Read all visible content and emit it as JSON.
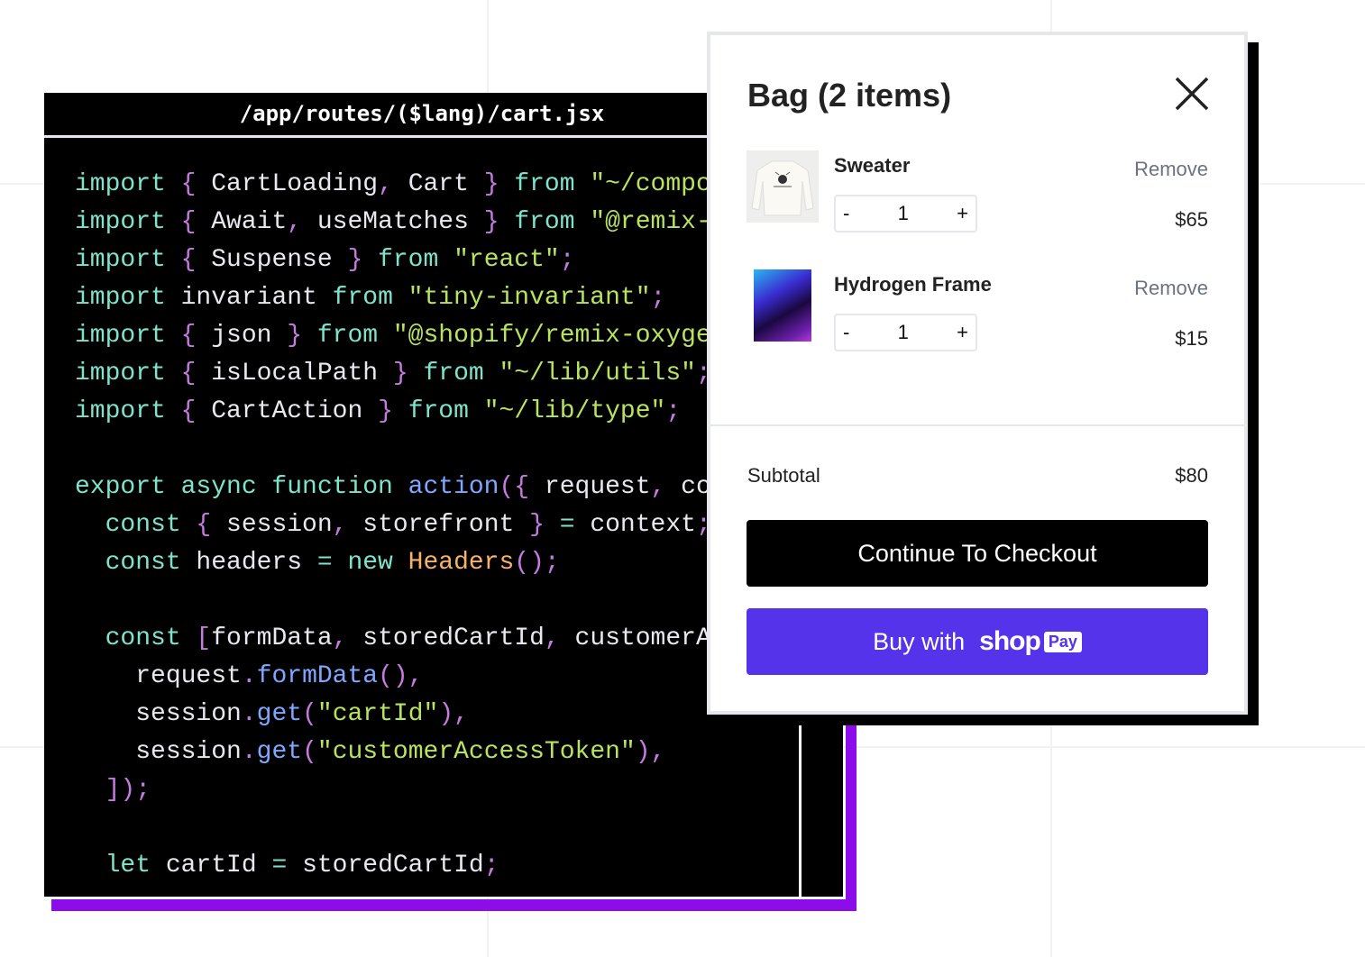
{
  "code_panel": {
    "filename": "/app/routes/($lang)/cart.jsx",
    "lines": [
      [
        [
          "import ",
          "kw"
        ],
        [
          "{ ",
          "pu"
        ],
        [
          "CartLoading",
          "id"
        ],
        [
          ", ",
          "pu"
        ],
        [
          "Cart ",
          "id"
        ],
        [
          "} ",
          "pu"
        ],
        [
          "from ",
          "kw"
        ],
        [
          "\"~/compo",
          "st"
        ]
      ],
      [
        [
          "import ",
          "kw"
        ],
        [
          "{ ",
          "pu"
        ],
        [
          "Await",
          "id"
        ],
        [
          ", ",
          "pu"
        ],
        [
          "useMatches ",
          "id"
        ],
        [
          "} ",
          "pu"
        ],
        [
          "from ",
          "kw"
        ],
        [
          "\"@remix-",
          "st"
        ]
      ],
      [
        [
          "import ",
          "kw"
        ],
        [
          "{ ",
          "pu"
        ],
        [
          "Suspense ",
          "id"
        ],
        [
          "} ",
          "pu"
        ],
        [
          "from ",
          "kw"
        ],
        [
          "\"react\"",
          "st"
        ],
        [
          ";",
          "pu"
        ]
      ],
      [
        [
          "import ",
          "kw"
        ],
        [
          "invariant ",
          "id"
        ],
        [
          "from ",
          "kw"
        ],
        [
          "\"tiny-invariant\"",
          "st"
        ],
        [
          ";",
          "pu"
        ]
      ],
      [
        [
          "import ",
          "kw"
        ],
        [
          "{ ",
          "pu"
        ],
        [
          "json ",
          "id"
        ],
        [
          "} ",
          "pu"
        ],
        [
          "from ",
          "kw"
        ],
        [
          "\"@shopify/remix-oxyge",
          "st"
        ]
      ],
      [
        [
          "import ",
          "kw"
        ],
        [
          "{ ",
          "pu"
        ],
        [
          "isLocalPath ",
          "id"
        ],
        [
          "} ",
          "pu"
        ],
        [
          "from ",
          "kw"
        ],
        [
          "\"~/lib/utils\"",
          "st"
        ],
        [
          ";",
          "pu"
        ]
      ],
      [
        [
          "import ",
          "kw"
        ],
        [
          "{ ",
          "pu"
        ],
        [
          "CartAction ",
          "id"
        ],
        [
          "} ",
          "pu"
        ],
        [
          "from ",
          "kw"
        ],
        [
          "\"~/lib/type\"",
          "st"
        ],
        [
          ";",
          "pu"
        ]
      ],
      [],
      [
        [
          "export async function ",
          "kw"
        ],
        [
          "action",
          "fn"
        ],
        [
          "({ ",
          "pu"
        ],
        [
          "request",
          "id"
        ],
        [
          ", ",
          "pu"
        ],
        [
          "co",
          "id"
        ]
      ],
      [
        [
          "  const ",
          "kw"
        ],
        [
          "{ ",
          "pu"
        ],
        [
          "session",
          "id"
        ],
        [
          ", ",
          "pu"
        ],
        [
          "storefront ",
          "id"
        ],
        [
          "} ",
          "pu"
        ],
        [
          "= ",
          "kw"
        ],
        [
          "context",
          "id"
        ],
        [
          ";",
          "pu"
        ]
      ],
      [
        [
          "  const ",
          "kw"
        ],
        [
          "headers ",
          "id"
        ],
        [
          "= new ",
          "kw"
        ],
        [
          "Headers",
          "cl"
        ],
        [
          "();",
          "pu"
        ]
      ],
      [],
      [
        [
          "  const ",
          "kw"
        ],
        [
          "[",
          "pu"
        ],
        [
          "formData",
          "id"
        ],
        [
          ", ",
          "pu"
        ],
        [
          "storedCartId",
          "id"
        ],
        [
          ", ",
          "pu"
        ],
        [
          "customerA",
          "id"
        ]
      ],
      [
        [
          "    request",
          "id"
        ],
        [
          ".",
          "pu"
        ],
        [
          "formData",
          "fn"
        ],
        [
          "(),",
          "pu"
        ]
      ],
      [
        [
          "    session",
          "id"
        ],
        [
          ".",
          "pu"
        ],
        [
          "get",
          "fn"
        ],
        [
          "(",
          "pu"
        ],
        [
          "\"cartId\"",
          "st"
        ],
        [
          "),",
          "pu"
        ]
      ],
      [
        [
          "    session",
          "id"
        ],
        [
          ".",
          "pu"
        ],
        [
          "get",
          "fn"
        ],
        [
          "(",
          "pu"
        ],
        [
          "\"customerAccessToken\"",
          "st"
        ],
        [
          "),",
          "pu"
        ]
      ],
      [
        [
          "  ]);",
          "pu"
        ]
      ],
      [],
      [
        [
          "  let ",
          "kw"
        ],
        [
          "cartId ",
          "id"
        ],
        [
          "= ",
          "kw"
        ],
        [
          "storedCartId",
          "id"
        ],
        [
          ";",
          "pu"
        ]
      ]
    ]
  },
  "cart": {
    "title": "Bag (2 items)",
    "items": [
      {
        "name": "Sweater",
        "quantity": "1",
        "price": "$65",
        "remove_label": "Remove",
        "minus": "-",
        "plus": "+"
      },
      {
        "name": "Hydrogen Frame",
        "quantity": "1",
        "price": "$15",
        "remove_label": "Remove",
        "minus": "-",
        "plus": "+"
      }
    ],
    "subtotal_label": "Subtotal",
    "subtotal_value": "$80",
    "checkout_label": "Continue To Checkout",
    "shoppay": {
      "prefix": "Buy with",
      "brand": "shop",
      "badge": "Pay"
    },
    "colors": {
      "shoppay": "#5433eb",
      "accent_purple": "#8c0cea"
    }
  }
}
